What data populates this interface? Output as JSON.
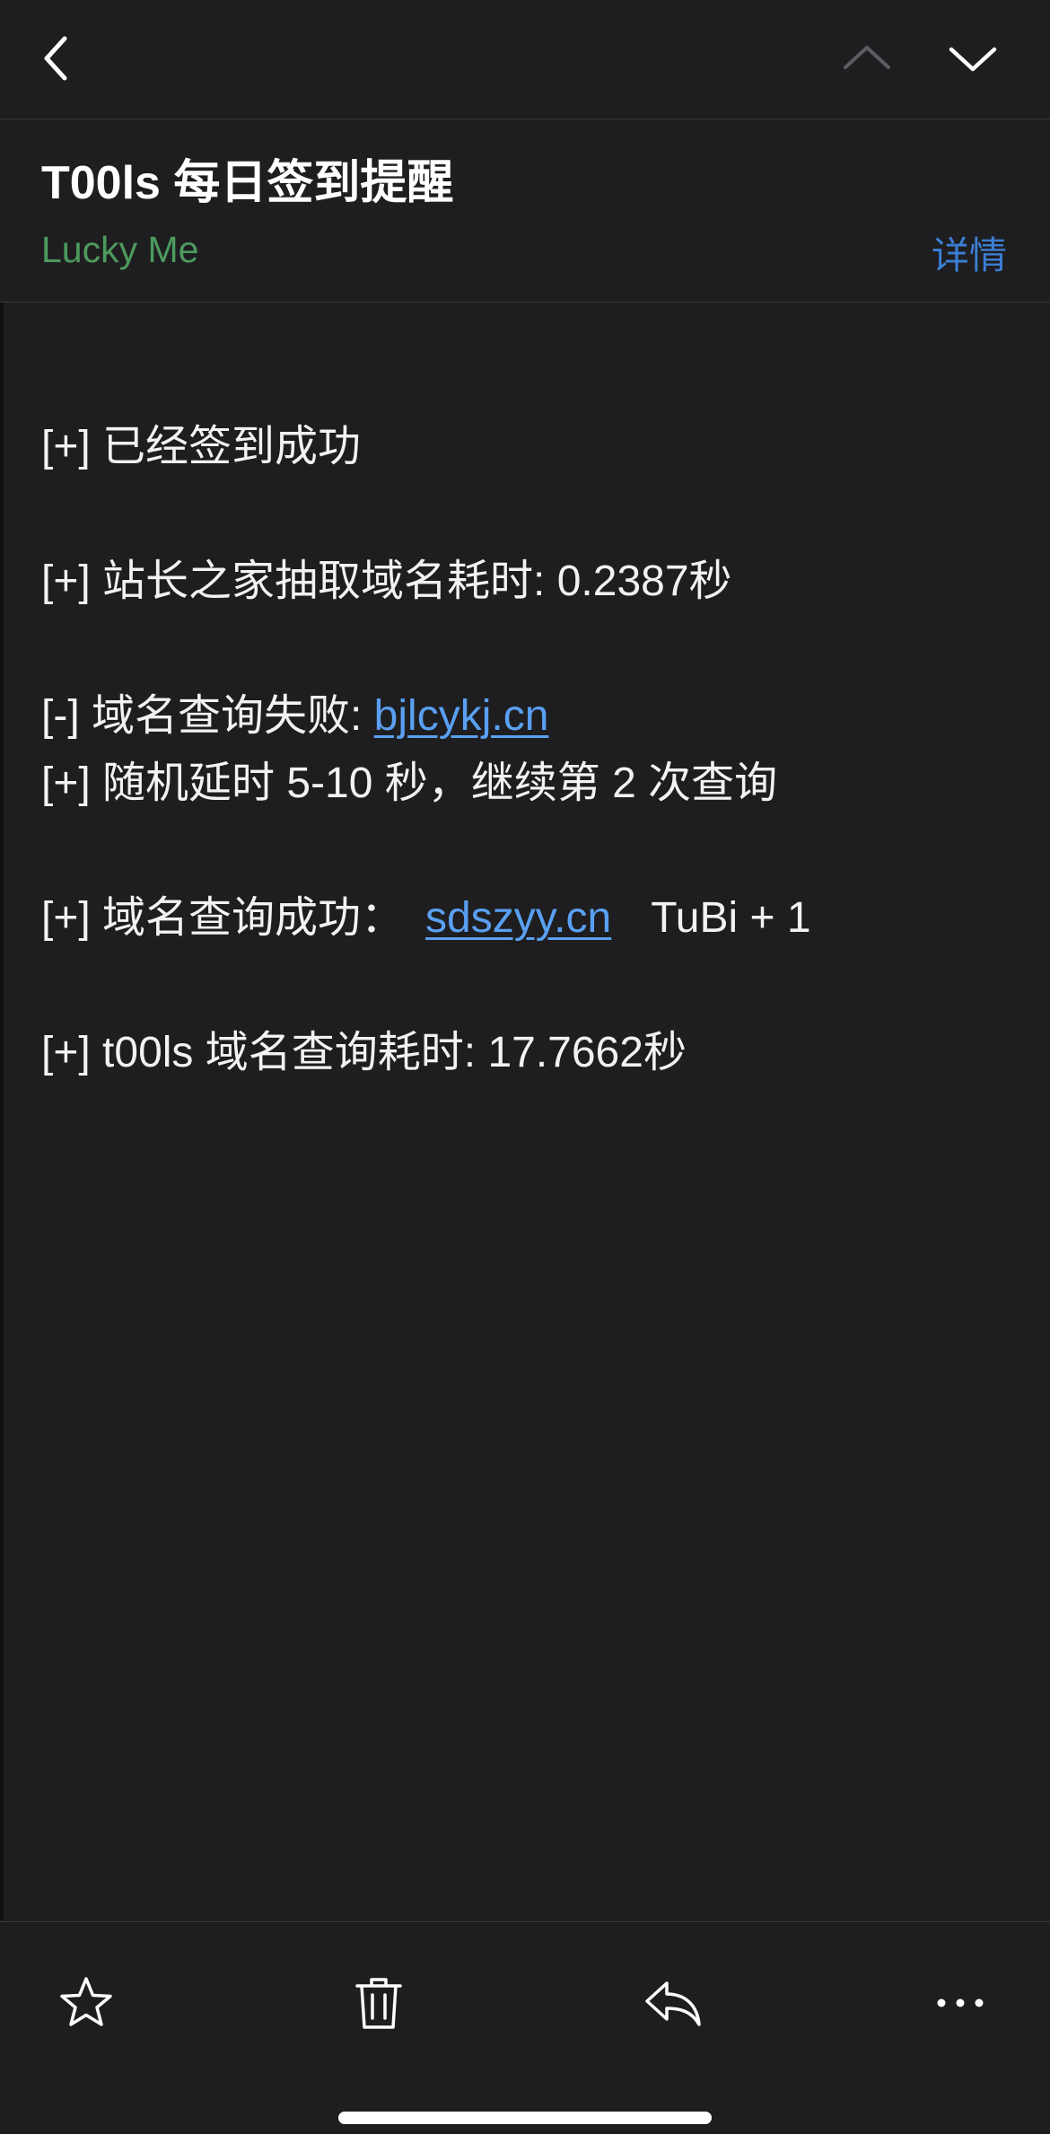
{
  "nav": {
    "back_icon": "chevron-left-icon",
    "prev_icon": "chevron-up-icon",
    "next_icon": "chevron-down-icon"
  },
  "header": {
    "subject": "T00ls 每日签到提醒",
    "sender": "Lucky Me",
    "details_label": "详情"
  },
  "body": {
    "line1": "[+] 已经签到成功",
    "line2": "[+] 站长之家抽取域名耗时: 0.2387秒",
    "line3_prefix": "[-] 域名查询失败: ",
    "line3_link": "bjlcykj.cn",
    "line4": "[+] 随机延时 5-10 秒，继续第 2 次查询",
    "line5_prefix": "[+] 域名查询成功：",
    "line5_link": "sdszyy.cn",
    "line5_suffix": "TuBi + 1",
    "line6": "[+] t00ls 域名查询耗时: 17.7662秒"
  },
  "toolbar": {
    "star_icon": "star-icon",
    "trash_icon": "trash-icon",
    "reply_icon": "reply-icon",
    "more_icon": "more-icon"
  },
  "colors": {
    "background": "#1e1e20",
    "sender": "#4d9a5d",
    "details": "#3b7fd4",
    "link": "#5aa0f2"
  }
}
